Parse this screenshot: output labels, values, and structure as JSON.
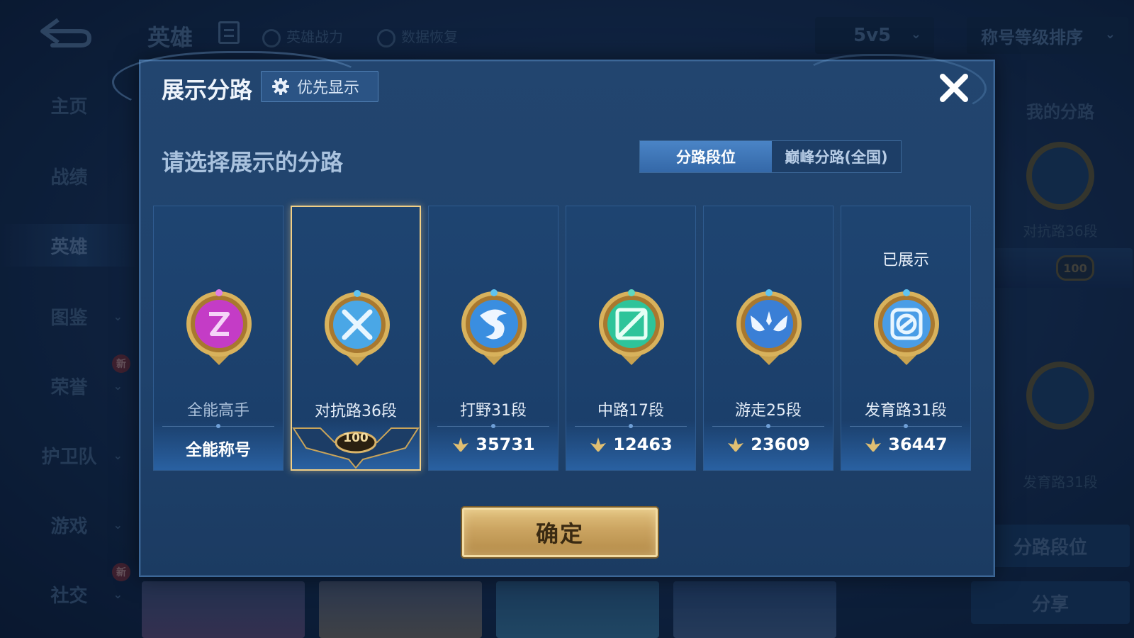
{
  "background": {
    "title": "英雄",
    "links": [
      "英雄战力",
      "数据恢复"
    ],
    "mode": "5v5",
    "sort": "称号等级排序",
    "sidebar": [
      {
        "label": "主页"
      },
      {
        "label": "战绩"
      },
      {
        "label": "英雄"
      },
      {
        "label": "图鉴"
      },
      {
        "label": "荣誉",
        "badge": "新"
      },
      {
        "label": "护卫队"
      },
      {
        "label": "游戏"
      },
      {
        "label": "社交",
        "badge": "新"
      }
    ],
    "right_panel": {
      "title": "我的分路",
      "lane1": "对抗路36段",
      "rank_badge": "100",
      "lane2": "发育路31段",
      "btn_lane_rank": "分路段位",
      "btn_share": "分享"
    }
  },
  "dialog": {
    "title": "展示分路",
    "priority_label": "优先显示",
    "subtitle": "请选择展示的分路",
    "tabs": [
      {
        "label": "分路段位",
        "active": true
      },
      {
        "label": "巅峰分路(全国)",
        "active": false
      }
    ],
    "cards": [
      {
        "name": "全能高手",
        "label": "全能称号",
        "emblem": "all-round-emblem",
        "color": "#c43cc6"
      },
      {
        "name": "对抗路36段",
        "rank_badge": "100",
        "selected": true,
        "emblem": "clash-lane-emblem",
        "color": "#4aa7e6"
      },
      {
        "name": "打野31段",
        "score": "35731",
        "emblem": "jungle-emblem",
        "color": "#3a8ee0"
      },
      {
        "name": "中路17段",
        "score": "12463",
        "emblem": "mid-lane-emblem",
        "color": "#2ec49a"
      },
      {
        "name": "游走25段",
        "score": "23609",
        "emblem": "roam-emblem",
        "color": "#3a7fd6"
      },
      {
        "name": "发育路31段",
        "score": "36447",
        "emblem": "farm-lane-emblem",
        "color": "#4a9de6",
        "shown": "已展示"
      }
    ],
    "confirm_label": "确定"
  }
}
